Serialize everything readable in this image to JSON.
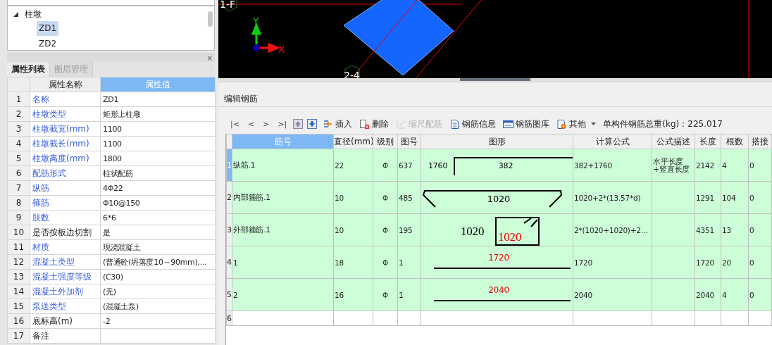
{
  "tree": {
    "items": [
      {
        "label": "柱墩",
        "expanded": true,
        "children": [
          {
            "label": "ZD1",
            "selected": true
          },
          {
            "label": "ZD2",
            "selected": false
          }
        ]
      }
    ]
  },
  "property_panel": {
    "close": "×",
    "tabs": [
      {
        "label": "属性列表",
        "selected": true
      },
      {
        "label": "图层管理",
        "selected": false
      }
    ],
    "columns": [
      {
        "label": "属性名称",
        "selected": false
      },
      {
        "label": "属性值",
        "selected": true
      }
    ],
    "rows": [
      {
        "number": "1",
        "name": "名称",
        "value": "ZD1",
        "public": true
      },
      {
        "number": "2",
        "name": "柱墩类型",
        "value": "矩形上柱墩",
        "public": true
      },
      {
        "number": "3",
        "name": "柱墩截宽(mm)",
        "value": "1100",
        "public": true
      },
      {
        "number": "4",
        "name": "柱墩截长(mm)",
        "value": "1100",
        "public": true
      },
      {
        "number": "5",
        "name": "柱墩高度(mm)",
        "value": "1800",
        "public": true
      },
      {
        "number": "6",
        "name": "配筋形式",
        "value": "柱状配筋",
        "public": true
      },
      {
        "number": "7",
        "name": "纵筋",
        "value": "4Φ22",
        "public": true
      },
      {
        "number": "8",
        "name": "箍筋",
        "value": "Φ10@150",
        "public": true
      },
      {
        "number": "9",
        "name": "肢数",
        "value": "6*6",
        "public": true
      },
      {
        "number": "10",
        "name": "是否按板边切割",
        "value": "是",
        "public": false
      },
      {
        "number": "11",
        "name": "材质",
        "value": "现浇混凝土",
        "public": true
      },
      {
        "number": "12",
        "name": "混凝土类型",
        "value": "(普通砼(坍落度10～90mm),...",
        "public": true
      },
      {
        "number": "13",
        "name": "混凝土强度等级",
        "value": "(C30)",
        "public": true
      },
      {
        "number": "14",
        "name": "混凝土外加剂",
        "value": "(无)",
        "public": true
      },
      {
        "number": "15",
        "name": "泵送类型",
        "value": "(混凝土泵)",
        "public": true
      },
      {
        "number": "16",
        "name": "底标高(m)",
        "value": "-2",
        "public": false
      },
      {
        "number": "17",
        "name": "备注",
        "public": false
      }
    ]
  },
  "canvas": {
    "axis_labels": [
      "1-F",
      "2-4"
    ],
    "axis_y": "Y",
    "axis_x": "X"
  },
  "rebar_editor": {
    "title": "编辑钢筋",
    "toolbar": {
      "nav": [
        "|<",
        "<",
        ">",
        ">|"
      ],
      "buttons": [
        {
          "label": "插入",
          "kind": "insert",
          "disabled": false
        },
        {
          "label": "删除",
          "kind": "delete",
          "disabled": false
        },
        {
          "label": "缩尺配筋",
          "kind": "scale",
          "disabled": true
        },
        {
          "label": "钢筋信息",
          "kind": "info",
          "disabled": false
        },
        {
          "label": "钢筋图库",
          "kind": "library",
          "disabled": false
        },
        {
          "label": "其他",
          "kind": "other",
          "disabled": false
        }
      ],
      "total_weight": "单构件钢筋总重(kg)：225.017"
    },
    "columns": [
      {
        "label": "筋号",
        "selected": true
      },
      {
        "label": "直径(mm)",
        "selected": false
      },
      {
        "label": "级别",
        "selected": false
      },
      {
        "label": "图号",
        "selected": false
      },
      {
        "label": "图形",
        "selected": false
      },
      {
        "label": "计算公式",
        "selected": false
      },
      {
        "label": "公式描述",
        "selected": false
      },
      {
        "label": "长度",
        "selected": false
      },
      {
        "label": "根数",
        "selected": false
      },
      {
        "label": "搭接",
        "selected": false
      }
    ],
    "rows": [
      {
        "number": "1",
        "selected": true,
        "name": "纵筋.1",
        "diameter": "22",
        "grade": "Φ",
        "shape_no": "637",
        "shape": {
          "kind": "bent",
          "labels": [
            "1760",
            "382"
          ]
        },
        "formula": "382+1760",
        "description": "水平长度+竖直长度",
        "length": "2142",
        "count": "4",
        "lap": "0"
      },
      {
        "number": "2",
        "selected": false,
        "name": "内部箍筋.1",
        "diameter": "10",
        "grade": "Φ",
        "shape_no": "485",
        "shape": {
          "kind": "hook",
          "labels": [
            "1020"
          ]
        },
        "formula": "1020+2*(13.57*d)",
        "length": "1291",
        "count": "104",
        "lap": "0"
      },
      {
        "number": "3",
        "selected": false,
        "name": "外部箍筋.1",
        "diameter": "10",
        "grade": "Φ",
        "shape_no": "195",
        "shape": {
          "kind": "stirrup",
          "labels": [
            "1020",
            "1020"
          ]
        },
        "formula": "2*(1020+1020)+2…",
        "length": "4351",
        "count": "13",
        "lap": "0"
      },
      {
        "number": "4",
        "selected": false,
        "name": "1",
        "diameter": "18",
        "grade": "Φ",
        "shape_no": "1",
        "shape": {
          "kind": "straight",
          "labels": [
            "1720"
          ]
        },
        "formula": "1720",
        "length": "1720",
        "count": "20",
        "lap": "0"
      },
      {
        "number": "5",
        "selected": false,
        "name": "2",
        "diameter": "16",
        "grade": "Φ",
        "shape_no": "1",
        "shape": {
          "kind": "straight",
          "labels": [
            "2040"
          ]
        },
        "formula": "2040",
        "length": "2040",
        "count": "4",
        "lap": "0"
      }
    ],
    "empty_row": {
      "number": "6"
    }
  }
}
